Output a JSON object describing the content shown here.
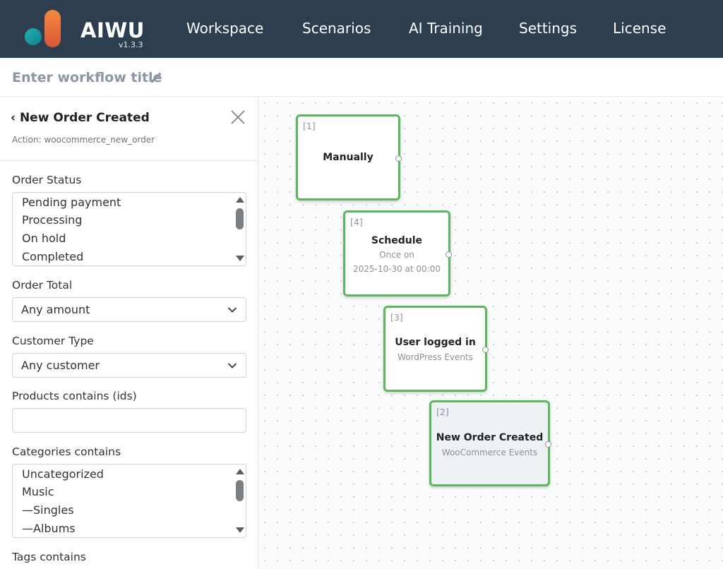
{
  "app": {
    "brand": "AIWU",
    "version": "v1.3.3",
    "colors": {
      "topbar": "#2d3e50",
      "node_border": "#5cb85c",
      "logo_orange": "#f07d3c",
      "logo_teal": "#1aa3a8"
    }
  },
  "nav": {
    "items": [
      {
        "label": "Workspace"
      },
      {
        "label": "Scenarios"
      },
      {
        "label": "AI Training"
      },
      {
        "label": "Settings"
      },
      {
        "label": "License"
      }
    ]
  },
  "workflow": {
    "title_placeholder": "Enter workflow title",
    "edit_icon": "pencil-icon"
  },
  "panel": {
    "back_label": "New Order Created",
    "action_text": "Action: woocommerce_new_order",
    "close_icon": "close-icon",
    "order_status": {
      "label": "Order Status",
      "options": [
        "Pending payment",
        "Processing",
        "On hold",
        "Completed"
      ]
    },
    "order_total": {
      "label": "Order Total",
      "value": "Any amount"
    },
    "customer_type": {
      "label": "Customer Type",
      "value": "Any customer"
    },
    "products": {
      "label": "Products contains (ids)",
      "value": ""
    },
    "categories": {
      "label": "Categories contains",
      "options": [
        "Uncategorized",
        "Music",
        "—Singles",
        "—Albums"
      ]
    },
    "tags": {
      "label": "Tags contains"
    }
  },
  "nodes": [
    {
      "index": "[1]",
      "title": "Manually",
      "subtitle": "",
      "subtitle2": ""
    },
    {
      "index": "[4]",
      "title": "Schedule",
      "subtitle": "Once on",
      "subtitle2": "2025-10-30 at 00:00"
    },
    {
      "index": "[3]",
      "title": "User logged in",
      "subtitle": "WordPress Events",
      "subtitle2": ""
    },
    {
      "index": "[2]",
      "title": "New Order Created",
      "subtitle": "WooCommerce Events",
      "subtitle2": ""
    }
  ]
}
